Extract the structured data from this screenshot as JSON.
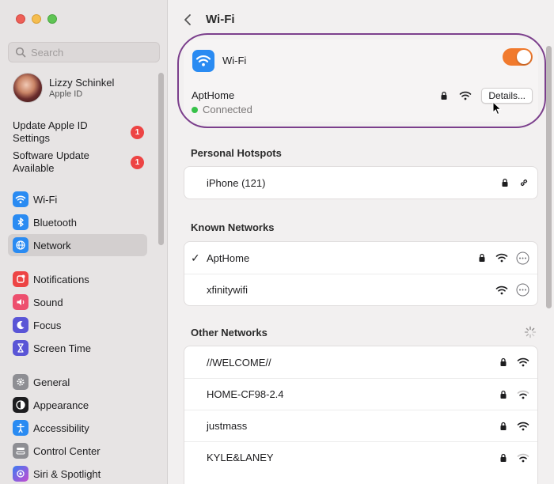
{
  "window": {
    "title": "Wi-Fi"
  },
  "sidebar": {
    "search_placeholder": "Search",
    "user": {
      "name": "Lizzy Schinkel",
      "subtitle": "Apple ID"
    },
    "notices": [
      {
        "text": "Update Apple ID Settings",
        "badge": "1"
      },
      {
        "text": "Software Update Available",
        "badge": "1"
      }
    ],
    "items": [
      {
        "label": "Wi-Fi",
        "icon": "wifi-icon",
        "color": "#2a8bf2"
      },
      {
        "label": "Bluetooth",
        "icon": "bluetooth-icon",
        "color": "#2a8bf2"
      },
      {
        "label": "Network",
        "icon": "globe-icon",
        "color": "#2a8bf2"
      },
      {
        "label": "Notifications",
        "icon": "bell-icon",
        "color": "#ed4444"
      },
      {
        "label": "Sound",
        "icon": "speaker-icon",
        "color": "#ed4f6e"
      },
      {
        "label": "Focus",
        "icon": "moon-icon",
        "color": "#5a55d6"
      },
      {
        "label": "Screen Time",
        "icon": "hourglass-icon",
        "color": "#5a55d6"
      },
      {
        "label": "General",
        "icon": "gear-icon",
        "color": "#8e8e93"
      },
      {
        "label": "Appearance",
        "icon": "appearance-icon",
        "color": "#1d1d1f"
      },
      {
        "label": "Accessibility",
        "icon": "accessibility-icon",
        "color": "#2a8bf2"
      },
      {
        "label": "Control Center",
        "icon": "control-center-icon",
        "color": "#8e8e93"
      },
      {
        "label": "Siri & Spotlight",
        "icon": "siri-icon",
        "color": "#6c4fd8"
      }
    ],
    "selected": "Network"
  },
  "wifi": {
    "label": "Wi-Fi",
    "enabled": true,
    "accent": "#f17a2d",
    "current_network": "AptHome",
    "status": "Connected",
    "details_label": "Details..."
  },
  "sections": {
    "hotspots_title": "Personal Hotspots",
    "hotspots": [
      {
        "name": "iPhone (121)"
      }
    ],
    "known_title": "Known Networks",
    "known": [
      {
        "name": "AptHome",
        "checked": true,
        "locked": true
      },
      {
        "name": "xfinitywifi",
        "checked": false,
        "locked": false
      }
    ],
    "other_title": "Other Networks",
    "other": [
      {
        "name": "//WELCOME//"
      },
      {
        "name": "HOME-CF98-2.4"
      },
      {
        "name": "justmass"
      },
      {
        "name": "KYLE&LANEY"
      }
    ]
  }
}
